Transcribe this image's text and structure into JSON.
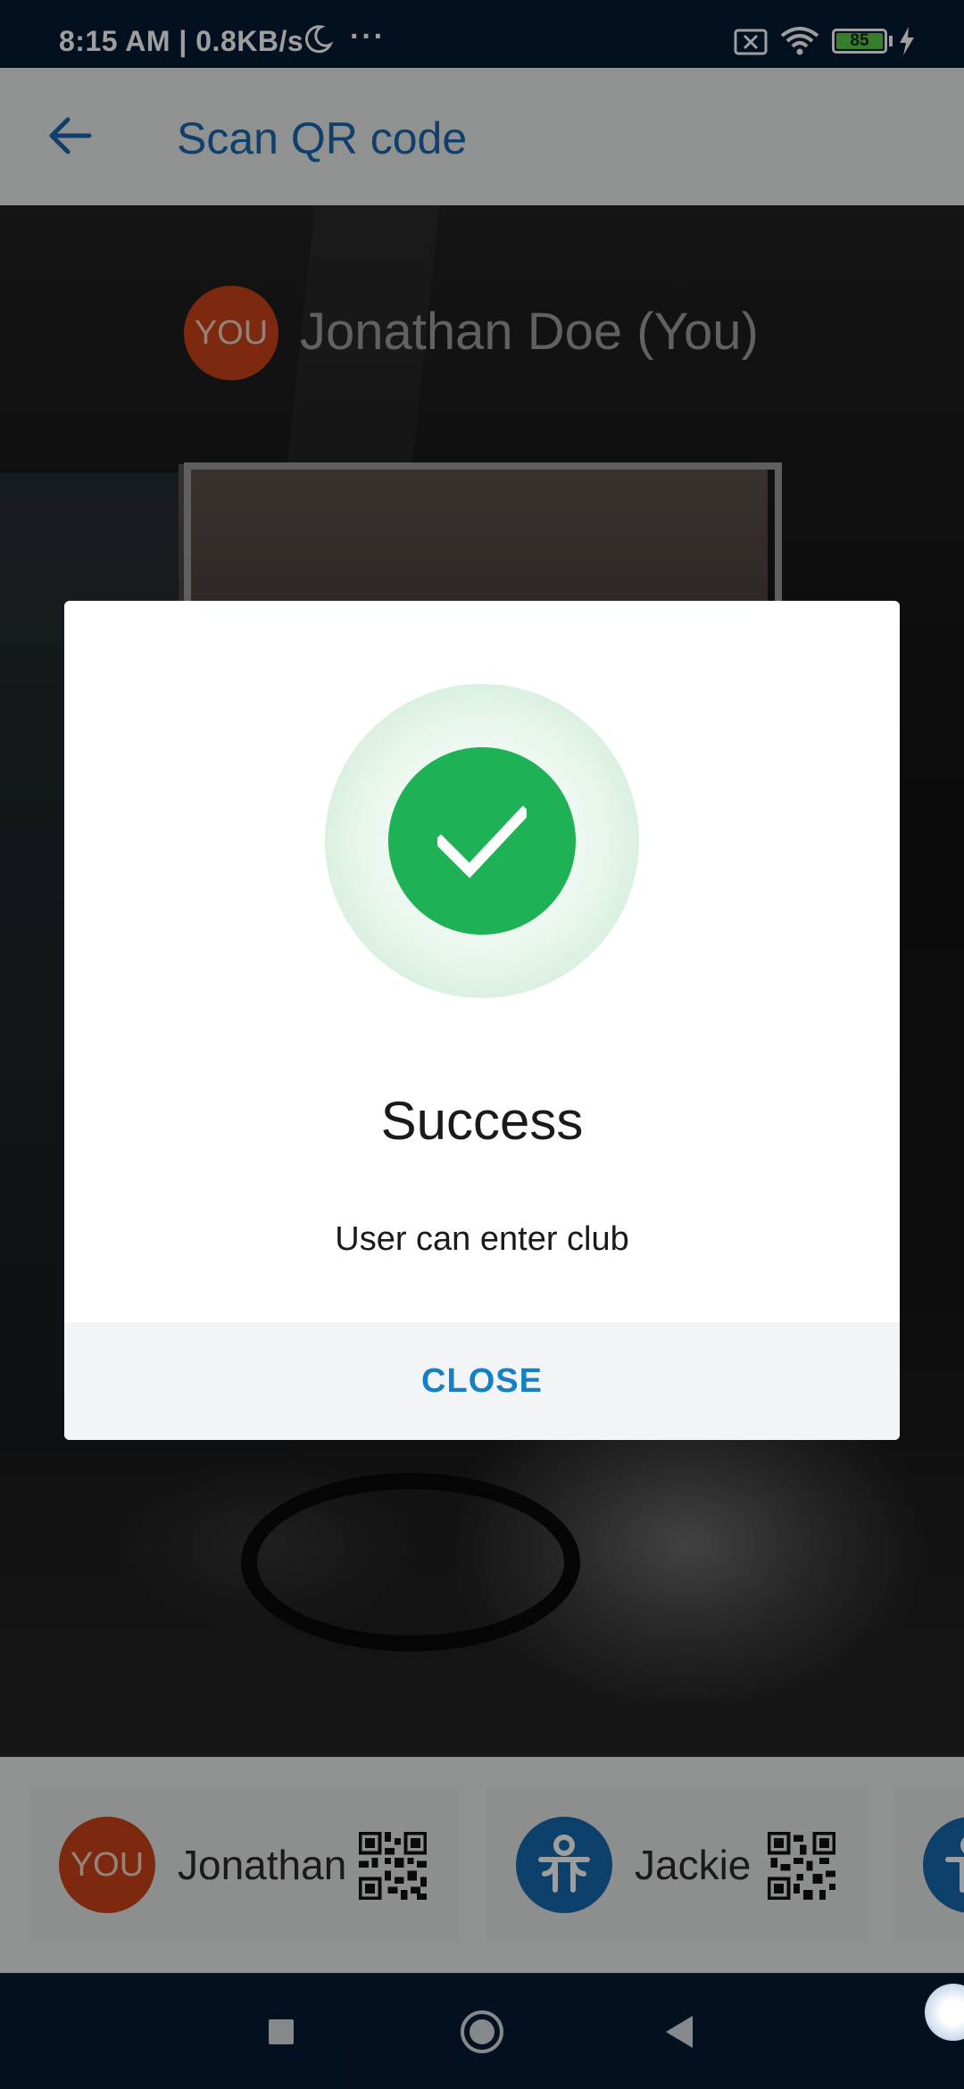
{
  "status_bar": {
    "time_speed": "8:15 AM | 0.8KB/s",
    "more": "···",
    "battery": "85",
    "icons": [
      "moon-icon",
      "no-sim-icon",
      "wifi-icon",
      "battery-icon",
      "charging-icon"
    ]
  },
  "app_bar": {
    "title": "Scan QR code",
    "back_icon": "arrow-left-icon"
  },
  "scanner": {
    "avatar_text": "YOU",
    "user_name": "Jonathan Doe (You)"
  },
  "dialog": {
    "title": "Success",
    "message": "User can enter club",
    "close_label": "CLOSE",
    "icon": "check-circle-icon",
    "accent": "#1fb155"
  },
  "user_list": [
    {
      "avatar_text": "YOU",
      "name": "Jonathan",
      "avatar_color": "#c9431a"
    },
    {
      "avatar_text": "",
      "name": "Jackie",
      "avatar_color": "#1668ad"
    },
    {
      "avatar_text": "",
      "name": "",
      "avatar_color": "#1668ad"
    }
  ],
  "nav_bar": {
    "buttons": [
      "recents-icon",
      "home-icon",
      "back-triangle-icon"
    ]
  },
  "colors": {
    "primary": "#1a66ad",
    "status_bar": "#061a33",
    "button_text": "#1581c5"
  }
}
